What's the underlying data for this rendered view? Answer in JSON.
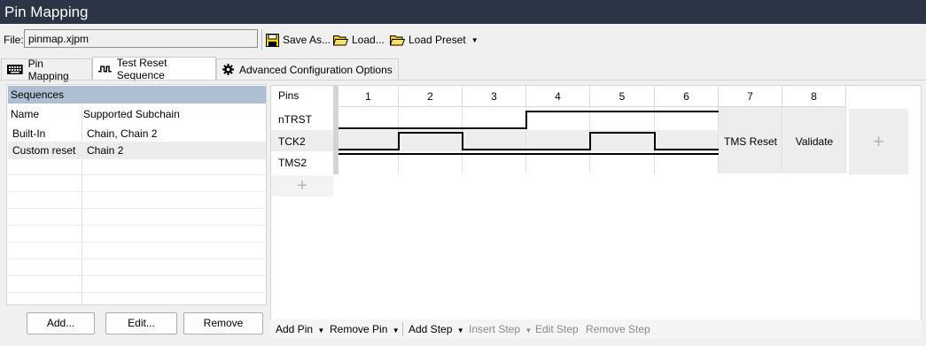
{
  "window": {
    "title": "Pin Mapping"
  },
  "filebar": {
    "label": "File:",
    "value": "pinmap.xjpm",
    "save_as": "Save As...",
    "load": "Load...",
    "load_preset": "Load Preset"
  },
  "tabs": [
    {
      "label": "Pin Mapping",
      "icon": "keyboard-icon"
    },
    {
      "label": "Test Reset Sequence",
      "icon": "waveform-icon",
      "active": true
    },
    {
      "label": "Advanced Configuration Options",
      "icon": "gear-icon"
    }
  ],
  "sequences": {
    "header": "Sequences",
    "col_name": "Name",
    "col_subchain": "Supported Subchain",
    "rows": [
      {
        "name": "Built-In",
        "subchain": "Chain, Chain 2"
      },
      {
        "name": "Custom reset",
        "subchain": "Chain 2",
        "selected": true
      }
    ],
    "buttons": {
      "add": "Add...",
      "edit": "Edit...",
      "remove": "Remove"
    }
  },
  "pins_grid": {
    "pins_header": "Pins",
    "steps": [
      "1",
      "2",
      "3",
      "4",
      "5",
      "6",
      "7",
      "8"
    ],
    "pins": [
      "nTRST",
      "TCK2",
      "TMS2"
    ],
    "step7_label": "TMS Reset",
    "step8_label": "Validate",
    "add_symbol": "+",
    "waveforms": {
      "nTRST": [
        0,
        0,
        0,
        1,
        1,
        1
      ],
      "TCK2": [
        0,
        1,
        0,
        0,
        1,
        0
      ],
      "TMS2": [
        1,
        1,
        1,
        1,
        1,
        1
      ]
    }
  },
  "bottom_toolbar": {
    "add_pin": "Add Pin",
    "remove_pin": "Remove Pin",
    "add_step": "Add Step",
    "insert_step": "Insert Step",
    "edit_step": "Edit Step",
    "remove_step": "Remove Step"
  },
  "colors": {
    "titlebar": "#2b3546",
    "selection": "#aebfd4",
    "folder": "#f5c518",
    "save": "#f5d000"
  }
}
